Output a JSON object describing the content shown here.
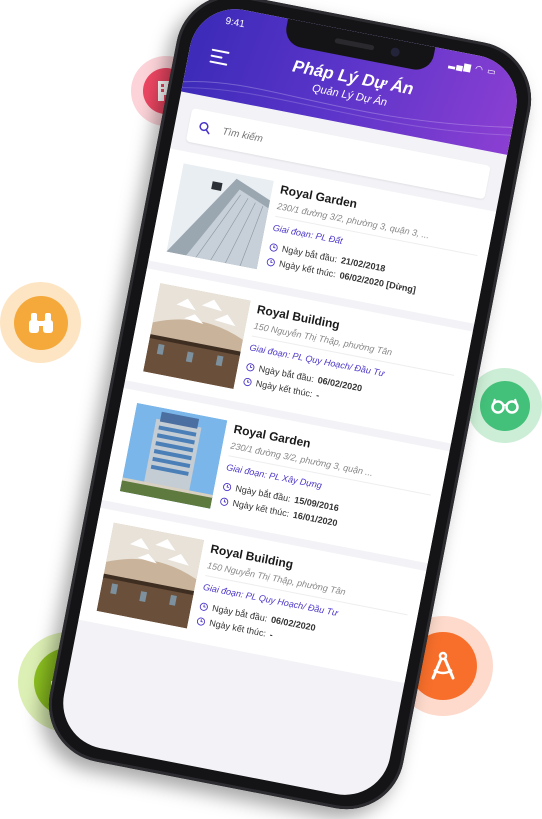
{
  "status": {
    "time": "9:41",
    "icons": "▂▄▆ ◠ ▭"
  },
  "header": {
    "title": "Pháp Lý Dự Án",
    "subtitle": "Quản Lý Dự Án"
  },
  "search": {
    "placeholder": "Tìm kiếm"
  },
  "projects": [
    {
      "name": "Royal Garden",
      "address": "230/1 đường 3/2, phường 3, quận 3, ...",
      "stage": "Giai đoạn: PL Đất",
      "start_label": "Ngày bắt đầu:",
      "start_value": "21/02/2018",
      "end_label": "Ngày kết thúc:",
      "end_value": "06/02/2020 [Dừng]",
      "thumb": "glass-tower"
    },
    {
      "name": "Royal Building",
      "address": "150 Nguyễn Thị Thập, phường Tân",
      "stage": "Giai đoạn: PL Quy Hoạch/ Đầu Tư",
      "start_label": "Ngày bắt đầu:",
      "start_value": "06/02/2020",
      "end_label": "Ngày kết thúc:",
      "end_value": "-",
      "thumb": "mall-interior"
    },
    {
      "name": "Royal Garden",
      "address": "230/1 đường 3/2, phường 3, quận ...",
      "stage": "Giai đoạn: PL Xây Dựng",
      "start_label": "Ngày bắt đầu:",
      "start_value": "15/09/2016",
      "end_label": "Ngày kết thúc:",
      "end_value": "16/01/2020",
      "thumb": "office-building"
    },
    {
      "name": "Royal Building",
      "address": "150 Nguyễn Thị Thập, phường Tân",
      "stage": "Giai đoạn: PL Quy Hoạch/ Đầu Tư",
      "start_label": "Ngày bắt đầu:",
      "start_value": "06/02/2020",
      "end_label": "Ngày kết thúc:",
      "end_value": "-",
      "thumb": "mall-interior"
    }
  ],
  "bubbles": [
    {
      "icon": "building-icon",
      "color": "#ec4662"
    },
    {
      "icon": "binoculars-icon",
      "color": "#f5a93a"
    },
    {
      "icon": "glasses-icon",
      "color": "#43c07a"
    },
    {
      "icon": "gears-icon",
      "color": "#8cc020"
    },
    {
      "icon": "compass-icon",
      "color": "#f86f2b"
    }
  ],
  "colors": {
    "accent": "#4b36c8",
    "header_start": "#3b2ab8",
    "header_end": "#8b3fd2"
  }
}
